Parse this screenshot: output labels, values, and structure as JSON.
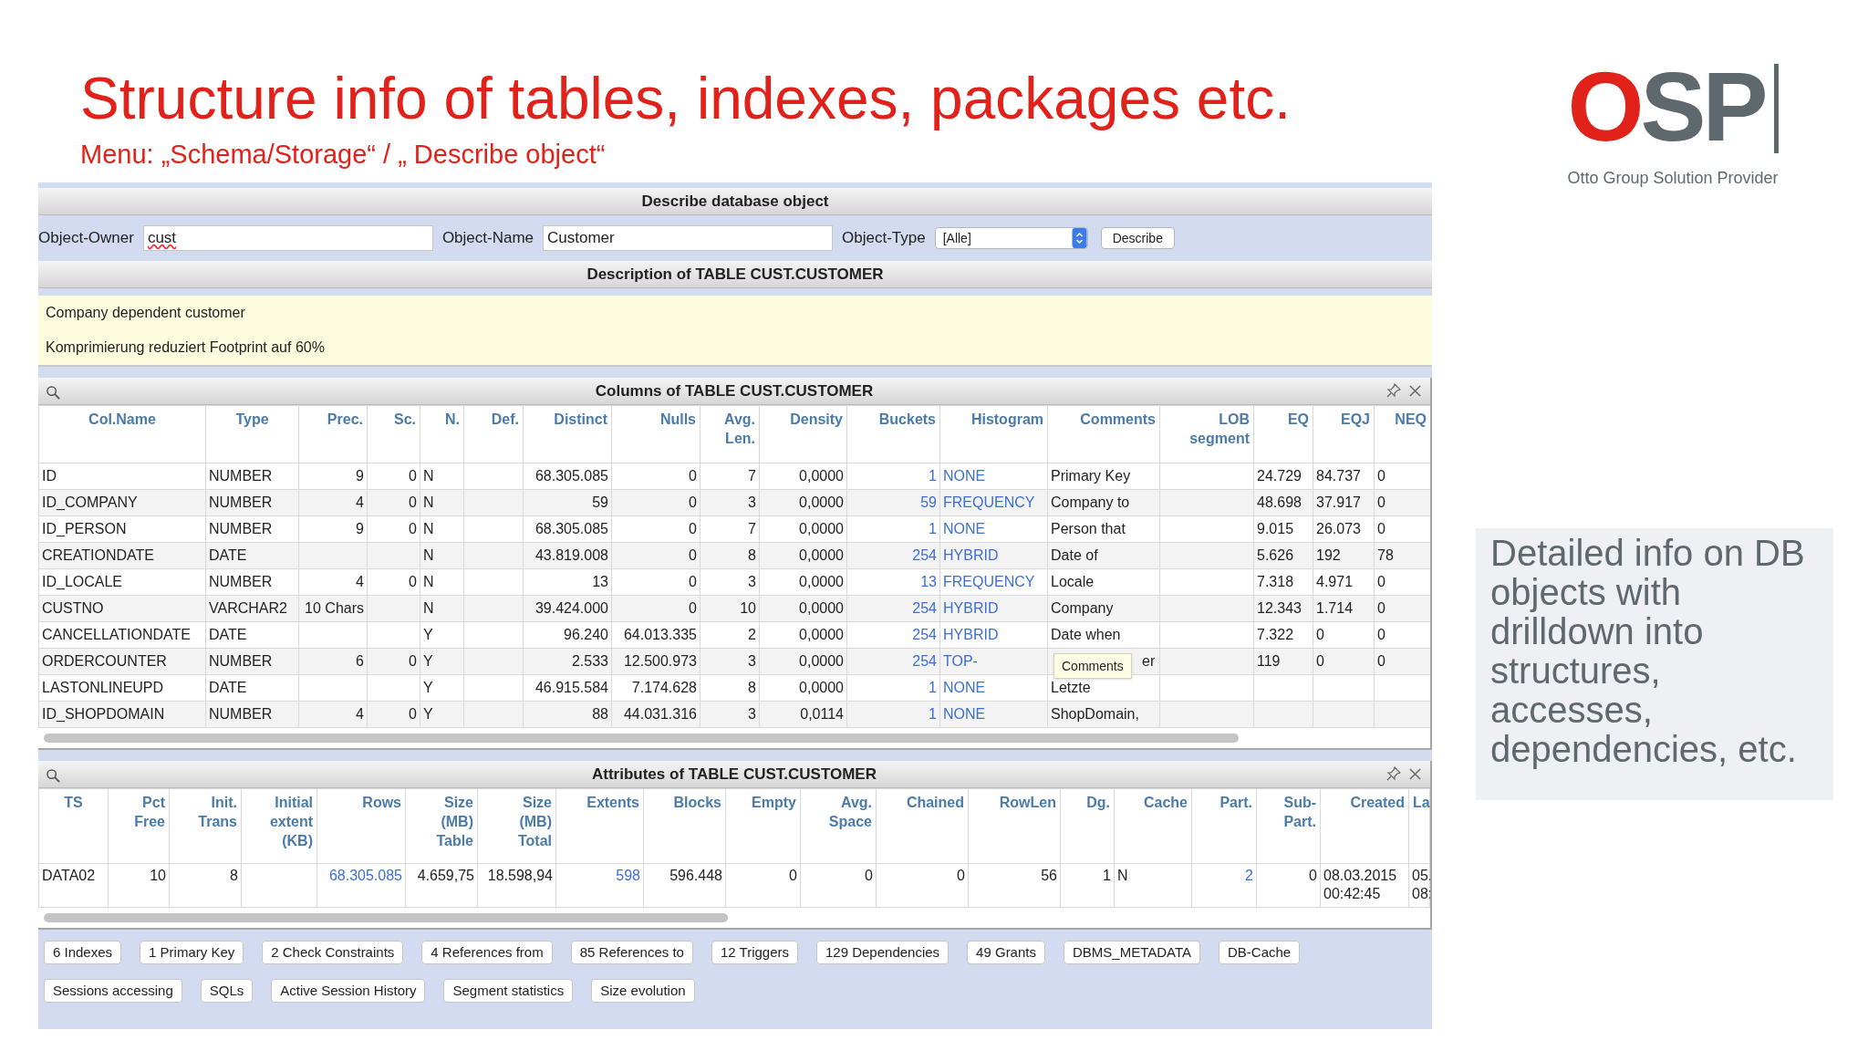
{
  "slide": {
    "title": "Structure info of tables, indexes, packages etc.",
    "subtitle": "Menu: „Schema/Storage“ / „ Describe object“"
  },
  "logo": {
    "mark": "OSP",
    "tagline": "Otto Group Solution Provider"
  },
  "callout": "Detailed info on DB objects with drilldown into structures, accesses, dependencies, etc.",
  "app": {
    "title": "Describe database object",
    "form": {
      "fields": [
        {
          "label": "Object-Owner",
          "value": "cust",
          "spellcheck_error": true
        },
        {
          "label": "Object-Name",
          "value": "Customer",
          "spellcheck_error": false
        }
      ],
      "type_label": "Object-Type",
      "type_value": "[Alle]",
      "button": "Describe"
    },
    "description": {
      "title": "Description of TABLE CUST.CUSTOMER",
      "lines": [
        "Company dependent customer",
        "Komprimierung reduziert Footprint auf 60%"
      ]
    },
    "columns_panel": {
      "title": "Columns of TABLE CUST.CUSTOMER",
      "columns": [
        {
          "label": "Col.Name",
          "kind": "text"
        },
        {
          "label": "Type",
          "kind": "text"
        },
        {
          "label": "Prec.",
          "kind": "num"
        },
        {
          "label": "Sc.",
          "kind": "num"
        },
        {
          "label": "N.",
          "kind": "text_rh"
        },
        {
          "label": "Def.",
          "kind": "num"
        },
        {
          "label": "Distinct",
          "kind": "num"
        },
        {
          "label": "Nulls",
          "kind": "num"
        },
        {
          "label": "Avg.\nLen.",
          "kind": "num"
        },
        {
          "label": "Density",
          "kind": "num"
        },
        {
          "label": "Buckets",
          "kind": "link_num"
        },
        {
          "label": "Histogram",
          "kind": "link_text"
        },
        {
          "label": "Comments",
          "kind": "text_rh"
        },
        {
          "label": "LOB\nsegment",
          "kind": "text_rh"
        },
        {
          "label": "EQ",
          "kind": "text_rh"
        },
        {
          "label": "EQJ",
          "kind": "text_rh"
        },
        {
          "label": "NEQ",
          "kind": "text_rh"
        }
      ],
      "rows": [
        {
          "cells": [
            "ID",
            "NUMBER",
            "9",
            "0",
            "N",
            "",
            "68.305.085",
            "0",
            "7",
            "0,0000",
            "1",
            "NONE",
            "Primary Key",
            "",
            "24.729",
            "84.737",
            "0"
          ]
        },
        {
          "cells": [
            "ID_COMPANY",
            "NUMBER",
            "4",
            "0",
            "N",
            "",
            "59",
            "0",
            "3",
            "0,0000",
            "59",
            "FREQUENCY",
            "Company to",
            "",
            "48.698",
            "37.917",
            "0"
          ]
        },
        {
          "cells": [
            "ID_PERSON",
            "NUMBER",
            "9",
            "0",
            "N",
            "",
            "68.305.085",
            "0",
            "7",
            "0,0000",
            "1",
            "NONE",
            "Person that",
            "",
            "9.015",
            "26.073",
            "0"
          ]
        },
        {
          "cells": [
            "CREATIONDATE",
            "DATE",
            "",
            "",
            "N",
            "",
            "43.819.008",
            "0",
            "8",
            "0,0000",
            "254",
            "HYBRID",
            "Date of",
            "",
            "5.626",
            "192",
            "78"
          ]
        },
        {
          "cells": [
            "ID_LOCALE",
            "NUMBER",
            "4",
            "0",
            "N",
            "",
            "13",
            "0",
            "3",
            "0,0000",
            "13",
            "FREQUENCY",
            "Locale",
            "",
            "7.318",
            "4.971",
            "0"
          ]
        },
        {
          "cells": [
            "CUSTNO",
            "VARCHAR2",
            "10 Chars",
            "",
            "N",
            "",
            "39.424.000",
            "0",
            "10",
            "0,0000",
            "254",
            "HYBRID",
            "Company",
            "",
            "12.343",
            "1.714",
            "0"
          ]
        },
        {
          "cells": [
            "CANCELLATIONDATE",
            "DATE",
            "",
            "",
            "Y",
            "",
            "96.240",
            "64.013.335",
            "2",
            "0,0000",
            "254",
            "HYBRID",
            "Date when",
            "",
            "7.322",
            "0",
            "0"
          ]
        },
        {
          "cells": [
            "ORDERCOUNTER",
            "NUMBER",
            "6",
            "0",
            "Y",
            "",
            "2.533",
            "12.500.973",
            "3",
            "0,0000",
            "254",
            "TOP-",
            "er",
            "",
            "119",
            "0",
            "0"
          ],
          "tooltip": "Comments"
        },
        {
          "cells": [
            "LASTONLINEUPD",
            "DATE",
            "",
            "",
            "Y",
            "",
            "46.915.584",
            "7.174.628",
            "8",
            "0,0000",
            "1",
            "NONE",
            "Letzte",
            "",
            "",
            "",
            ""
          ]
        },
        {
          "cells": [
            "ID_SHOPDOMAIN",
            "NUMBER",
            "4",
            "0",
            "Y",
            "",
            "88",
            "44.031.316",
            "3",
            "0,0114",
            "1",
            "NONE",
            "ShopDomain,",
            "",
            "",
            "",
            ""
          ]
        }
      ]
    },
    "attributes_panel": {
      "title": "Attributes of TABLE CUST.CUSTOMER",
      "columns": [
        {
          "label": "TS",
          "kind": "text"
        },
        {
          "label": "Pct\nFree",
          "kind": "num"
        },
        {
          "label": "Init.\nTrans",
          "kind": "num"
        },
        {
          "label": "Initial\nextent\n(KB)",
          "kind": "num"
        },
        {
          "label": "Rows",
          "kind": "link_num"
        },
        {
          "label": "Size\n(MB)\nTable",
          "kind": "num"
        },
        {
          "label": "Size\n(MB)\nTotal",
          "kind": "num"
        },
        {
          "label": "Extents",
          "kind": "link_num"
        },
        {
          "label": "Blocks",
          "kind": "num"
        },
        {
          "label": "Empty",
          "kind": "num"
        },
        {
          "label": "Avg.\nSpace",
          "kind": "num"
        },
        {
          "label": "Chained",
          "kind": "num"
        },
        {
          "label": "RowLen",
          "kind": "num"
        },
        {
          "label": "Dg.",
          "kind": "num"
        },
        {
          "label": "Cache",
          "kind": "text_rh"
        },
        {
          "label": "Part.",
          "kind": "link_num"
        },
        {
          "label": "Sub-\nPart.",
          "kind": "num"
        },
        {
          "label": "Created",
          "kind": "text_rh"
        },
        {
          "label": "La",
          "kind": "text"
        }
      ],
      "rows": [
        {
          "cells": [
            "DATA02",
            "10",
            "8",
            "",
            "68.305.085",
            "4.659,75",
            "18.598,94",
            "598",
            "596.448",
            "0",
            "0",
            "0",
            "56",
            "1",
            "N",
            "2",
            "0",
            "08.03.2015\n00:42:45",
            "05.\n08:"
          ]
        }
      ]
    },
    "button_rows": [
      [
        "6 Indexes",
        "1 Primary Key",
        "2 Check Constraints",
        "4 References from",
        "85 References to",
        "12 Triggers",
        "129 Dependencies",
        "49 Grants",
        "DBMS_METADATA",
        "DB-Cache"
      ],
      [
        "Sessions accessing",
        "SQLs",
        "Active Session History",
        "Segment statistics",
        "Size evolution"
      ]
    ]
  }
}
